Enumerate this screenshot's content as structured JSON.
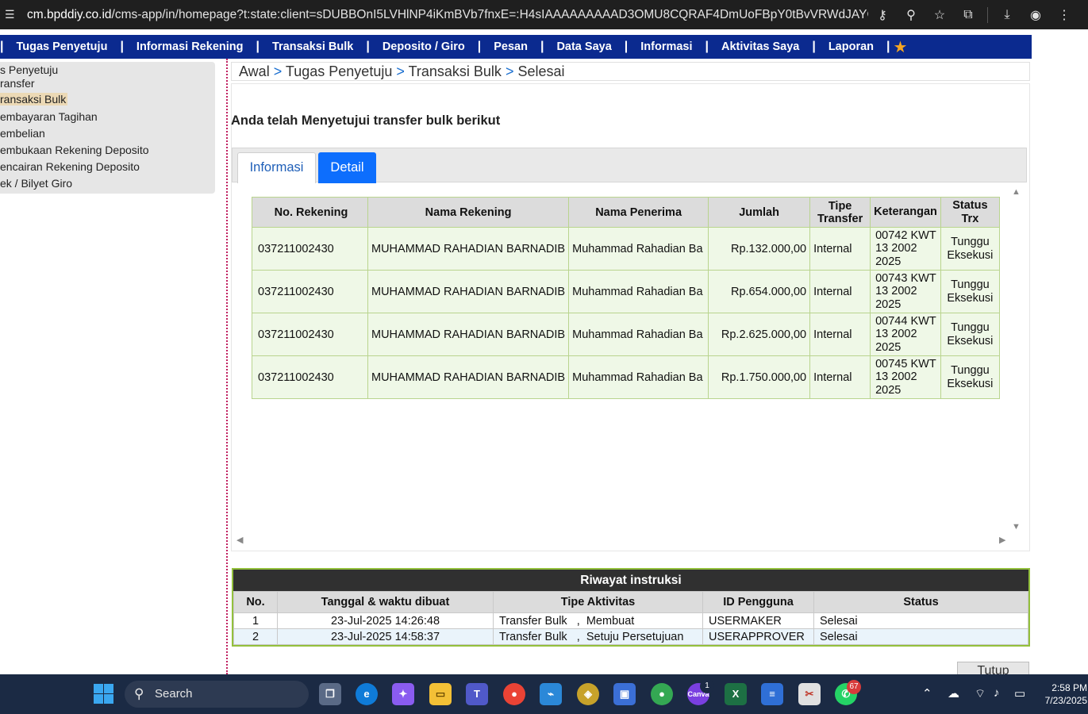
{
  "browser": {
    "url_host": "cm.bpddiy.co.id",
    "url_rest": "/cms-app/in/homepage?t:state:client=sDUBBOnI5LVHlNP4iKmBVb7fnxE=:H4sIAAAAAAAAAD3OMU8CQRAF4DmUoFBpY0tBvVRWdJAYCBdjghXd..."
  },
  "topnav": {
    "items": [
      "Tugas Penyetuju",
      "Informasi Rekening",
      "Transaksi Bulk",
      "Deposito / Giro",
      "Pesan",
      "Data Saya",
      "Informasi",
      "Aktivitas Saya",
      "Laporan"
    ],
    "separator": "|"
  },
  "sidebar": {
    "items": [
      "s Penyetuju",
      "ransfer",
      "ransaksi Bulk",
      "embayaran Tagihan",
      "embelian",
      "embukaan Rekening Deposito",
      "encairan Rekening Deposito",
      "ek / Bilyet Giro"
    ]
  },
  "breadcrumb": {
    "items": [
      "Awal",
      "Tugas Penyetuju",
      "Transaksi Bulk",
      "Selesai"
    ],
    "separator": ">"
  },
  "main": {
    "heading": "Anda telah Menyetujui transfer bulk berikut",
    "tabs": [
      "Informasi",
      "Detail"
    ],
    "active_tab": "Detail"
  },
  "detail_table": {
    "headers": [
      "No. Rekening",
      "Nama Rekening",
      "Nama Penerima",
      "Jumlah",
      "Tipe Transfer",
      "Keterangan",
      "Status Trx"
    ],
    "rows": [
      [
        "037211002430",
        "MUHAMMAD RAHADIAN BARNADIB",
        "Muhammad Rahadian Ba",
        "Rp.132.000,00",
        "Internal",
        "00742 KWT 13 2002 2025",
        "Tunggu Eksekusi"
      ],
      [
        "037211002430",
        "MUHAMMAD RAHADIAN BARNADIB",
        "Muhammad Rahadian Ba",
        "Rp.654.000,00",
        "Internal",
        "00743 KWT 13 2002 2025",
        "Tunggu Eksekusi"
      ],
      [
        "037211002430",
        "MUHAMMAD RAHADIAN BARNADIB",
        "Muhammad Rahadian Ba",
        "Rp.2.625.000,00",
        "Internal",
        "00744 KWT 13 2002 2025",
        "Tunggu Eksekusi"
      ],
      [
        "037211002430",
        "MUHAMMAD RAHADIAN BARNADIB",
        "Muhammad Rahadian Ba",
        "Rp.1.750.000,00",
        "Internal",
        "00745 KWT 13 2002 2025",
        "Tunggu Eksekusi"
      ]
    ]
  },
  "riwayat": {
    "title": "Riwayat instruksi",
    "headers": [
      "No.",
      "Tanggal & waktu dibuat",
      "Tipe Aktivitas",
      "ID Pengguna",
      "Status"
    ],
    "rows": [
      [
        "1",
        "23-Jul-2025 14:26:48",
        "Transfer Bulk   ,  Membuat",
        "USERMAKER",
        "Selesai"
      ],
      [
        "2",
        "23-Jul-2025 14:58:37",
        "Transfer Bulk   ,  Setuju Persetujuan",
        "USERAPPROVER",
        "Selesai"
      ]
    ]
  },
  "close_button": "Tutup",
  "taskbar": {
    "search_placeholder": "Search",
    "time": "2:58 PM",
    "date": "7/23/2025",
    "badge_teams": "1",
    "badge_whatsapp": "67"
  },
  "colors": {
    "nav_bg": "#0b2a8f",
    "active_tab": "#0d6efd",
    "table_border": "#b9d48e",
    "riwayat_border": "#93c03c"
  }
}
